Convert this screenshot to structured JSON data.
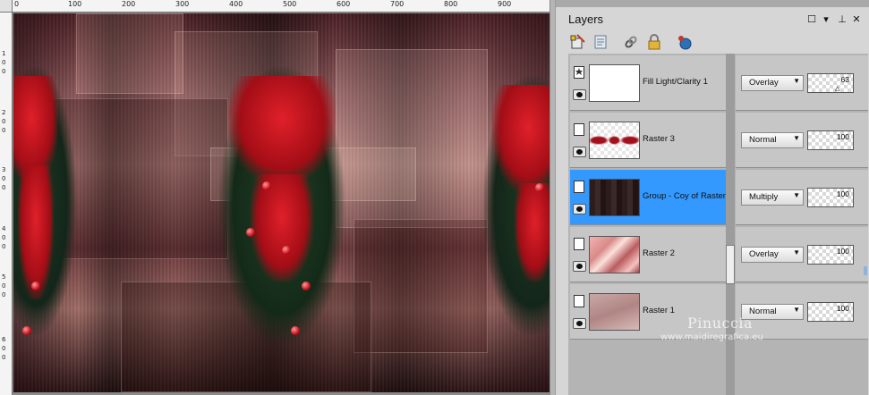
{
  "ruler": {
    "top_ticks": [
      "0",
      "100",
      "200",
      "300",
      "400",
      "500",
      "600",
      "700",
      "800",
      "900"
    ],
    "left_ticks": [
      "1",
      "0",
      "0",
      "2",
      "0",
      "0",
      "3",
      "0",
      "0",
      "4",
      "0",
      "0",
      "5",
      "0",
      "0",
      "6",
      "0",
      "0"
    ]
  },
  "layers_panel": {
    "title": "Layers",
    "header_icons": [
      "maximize-icon",
      "dropdown-icon",
      "pin-icon",
      "close-icon"
    ],
    "header_glyphs": [
      "☐",
      "▾",
      "⊥",
      "✕"
    ],
    "toolbar_icons": [
      "new-layer-icon",
      "properties-icon",
      "link-icon",
      "lock-icon",
      "mask-icon"
    ],
    "layers": [
      {
        "name": "Fill Light/Clarity 1",
        "blend": "Overlay",
        "opacity": "63",
        "selected": false,
        "kind": "adjustment"
      },
      {
        "name": "Raster 3",
        "blend": "Normal",
        "opacity": "100",
        "selected": false,
        "kind": "raster"
      },
      {
        "name": "Group - Coy of Raster",
        "blend": "Multiply",
        "opacity": "100",
        "selected": true,
        "kind": "group"
      },
      {
        "name": "Raster 2",
        "blend": "Overlay",
        "opacity": "100",
        "selected": false,
        "kind": "raster"
      },
      {
        "name": "Raster 1",
        "blend": "Normal",
        "opacity": "100",
        "selected": false,
        "kind": "raster"
      }
    ]
  },
  "watermark": {
    "name": "Pinuccia",
    "url": "www.maidiregrafica.eu"
  },
  "colors": {
    "selection": "#3399ff",
    "panel_bg": "#d6d6d6",
    "list_bg": "#b4b4b4"
  }
}
